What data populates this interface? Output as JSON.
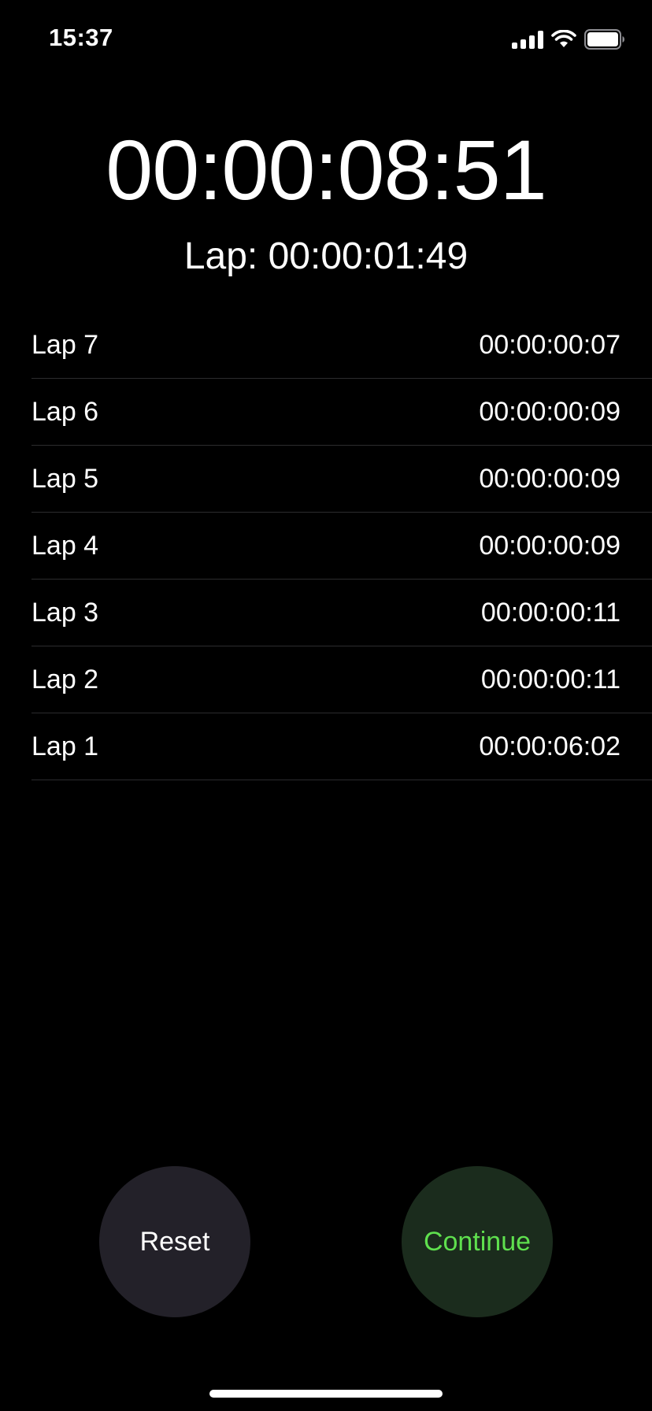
{
  "status_bar": {
    "time": "15:37",
    "icons": [
      "cellular-signal-icon",
      "wifi-icon",
      "battery-icon"
    ]
  },
  "stopwatch": {
    "main_time": "00:00:08:51",
    "current_lap": "Lap: 00:00:01:49"
  },
  "laps": [
    {
      "label": "Lap 7",
      "time": "00:00:00:07"
    },
    {
      "label": "Lap 6",
      "time": "00:00:00:09"
    },
    {
      "label": "Lap 5",
      "time": "00:00:00:09"
    },
    {
      "label": "Lap 4",
      "time": "00:00:00:09"
    },
    {
      "label": "Lap 3",
      "time": "00:00:00:11"
    },
    {
      "label": "Lap 2",
      "time": "00:00:00:11"
    },
    {
      "label": "Lap 1",
      "time": "00:00:06:02"
    }
  ],
  "controls": {
    "reset_label": "Reset",
    "continue_label": "Continue"
  },
  "colors": {
    "background": "#000000",
    "reset_button_bg": "#232129",
    "continue_button_bg": "#1b2c1d",
    "continue_text": "#5fe04e",
    "separator": "#2c2c2e"
  }
}
